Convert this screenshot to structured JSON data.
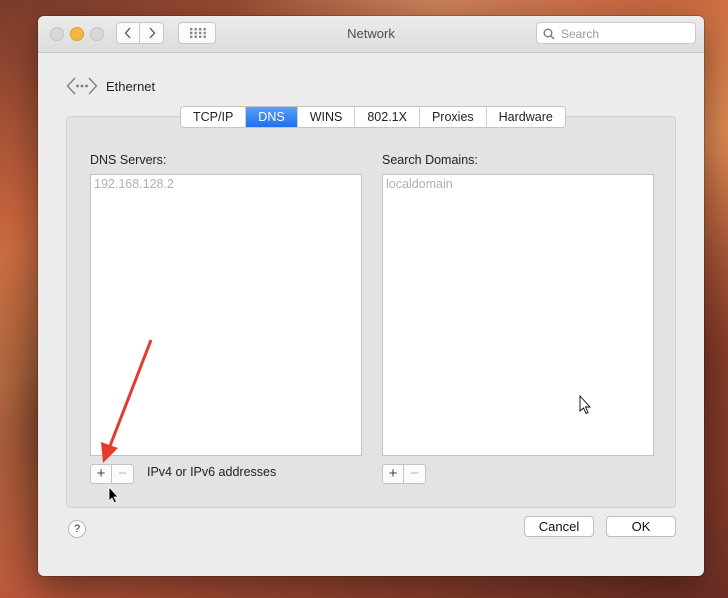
{
  "window": {
    "title": "Network"
  },
  "search": {
    "placeholder": "Search"
  },
  "interface": {
    "name": "Ethernet"
  },
  "tabs": [
    {
      "label": "TCP/IP",
      "active": false
    },
    {
      "label": "DNS",
      "active": true
    },
    {
      "label": "WINS",
      "active": false
    },
    {
      "label": "802.1X",
      "active": false
    },
    {
      "label": "Proxies",
      "active": false
    },
    {
      "label": "Hardware",
      "active": false
    }
  ],
  "dns_servers": {
    "label": "DNS Servers:",
    "items": [
      "192.168.128.2"
    ],
    "hint": "IPv4 or IPv6 addresses"
  },
  "search_domains": {
    "label": "Search Domains:",
    "items": [
      "localdomain"
    ]
  },
  "controls": {
    "plus": "+",
    "minus": "−"
  },
  "footer": {
    "help": "?",
    "cancel": "Cancel",
    "ok": "OK"
  },
  "colors": {
    "accent": "#1c6ff0",
    "annotation_arrow": "#e53b2f",
    "minimize": "#f6b73d"
  }
}
